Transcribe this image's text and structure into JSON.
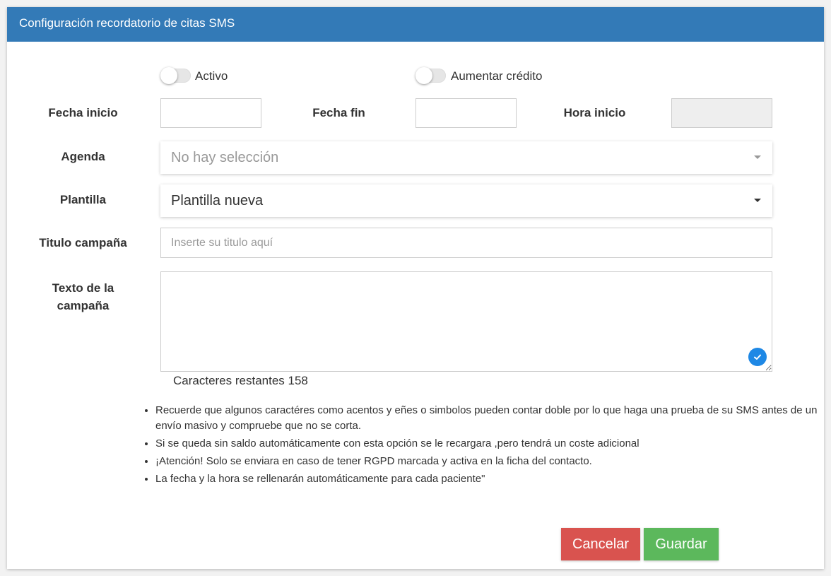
{
  "header": {
    "title": "Configuración recordatorio de citas SMS"
  },
  "toggles": {
    "activo": {
      "label": "Activo",
      "on": false
    },
    "aumentar_credito": {
      "label": "Aumentar crédito",
      "on": false
    }
  },
  "fields": {
    "fecha_inicio": {
      "label": "Fecha inicio",
      "value": ""
    },
    "fecha_fin": {
      "label": "Fecha fin",
      "value": ""
    },
    "hora_inicio": {
      "label": "Hora inicio",
      "value": ""
    },
    "agenda": {
      "label": "Agenda",
      "value": "No hay selección"
    },
    "plantilla": {
      "label": "Plantilla",
      "value": "Plantilla nueva"
    },
    "titulo": {
      "label": "Titulo campaña",
      "placeholder": "Inserte su titulo aquí",
      "value": ""
    },
    "texto": {
      "label_line1": "Texto de la",
      "label_line2": "campaña",
      "value": ""
    }
  },
  "counter": {
    "text": "Caracteres restantes 158"
  },
  "notes": [
    "Recuerde que algunos caractéres como acentos y eñes o simbolos pueden contar doble por lo que haga una prueba de su SMS antes de un envío masivo y compruebe que no se corta.",
    "Si se queda sin saldo automáticamente con esta opción se le recargara ,pero tendrá un coste adicional",
    "¡Atención! Solo se enviara en caso de tener RGPD marcada y activa en la ficha del contacto.",
    "La fecha y la hora se rellenarán automáticamente para cada paciente\""
  ],
  "buttons": {
    "cancel": "Cancelar",
    "save": "Guardar"
  },
  "colors": {
    "header": "#337ab7",
    "cancel": "#d9534f",
    "save": "#5cb85c",
    "check_badge": "#1e88e5"
  },
  "icons": {
    "textarea_badge": "checkmark-icon",
    "select_caret": "caret-down-icon"
  }
}
